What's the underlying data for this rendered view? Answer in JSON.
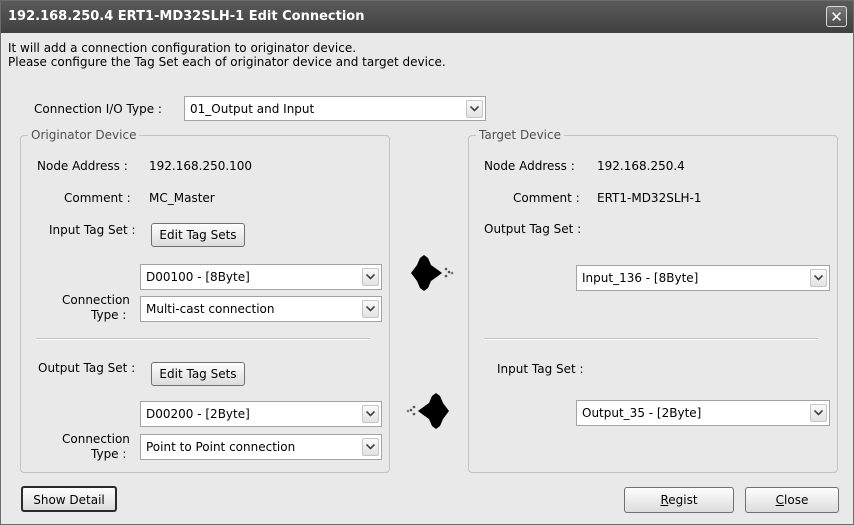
{
  "window": {
    "title": "192.168.250.4 ERT1-MD32SLH-1 Edit Connection",
    "intro_line1": "It will add a connection configuration to originator device.",
    "intro_line2": "Please configure the Tag Set each of originator device and target device."
  },
  "connection_io_type": {
    "label": "Connection I/O Type :",
    "value": "01_Output and Input"
  },
  "originator": {
    "caption": "Originator Device",
    "node_address_label": "Node Address :",
    "node_address": "192.168.250.100",
    "comment_label": "Comment :",
    "comment": "MC_Master",
    "input": {
      "label": "Input Tag Set :",
      "edit_button": "Edit Tag Sets",
      "tag_set": "D00100 - [8Byte]",
      "conn_type_label1": "Connection",
      "conn_type_label2": "Type :",
      "conn_type": "Multi-cast connection"
    },
    "output": {
      "label": "Output Tag Set :",
      "edit_button": "Edit Tag Sets",
      "tag_set": "D00200 - [2Byte]",
      "conn_type_label1": "Connection",
      "conn_type_label2": "Type :",
      "conn_type": "Point to Point connection"
    }
  },
  "target": {
    "caption": "Target Device",
    "node_address_label": "Node Address :",
    "node_address": "192.168.250.4",
    "comment_label": "Comment :",
    "comment": "ERT1-MD32SLH-1",
    "output_tag_label": "Output Tag Set :",
    "output_tag_set": "Input_136 - [8Byte]",
    "input_tag_label": "Input Tag Set :",
    "input_tag_set": "Output_35 - [2Byte]"
  },
  "buttons": {
    "show_detail": "Show Detail",
    "regist_hotkey": "R",
    "regist_rest": "egist",
    "close_hotkey": "C",
    "close_rest": "lose"
  },
  "icons": {
    "arrow_right": "data-flow-right-arrow-icon",
    "arrow_left": "data-flow-left-arrow-icon",
    "combo_arrow": "chevron-down-icon",
    "close": "close-icon"
  }
}
